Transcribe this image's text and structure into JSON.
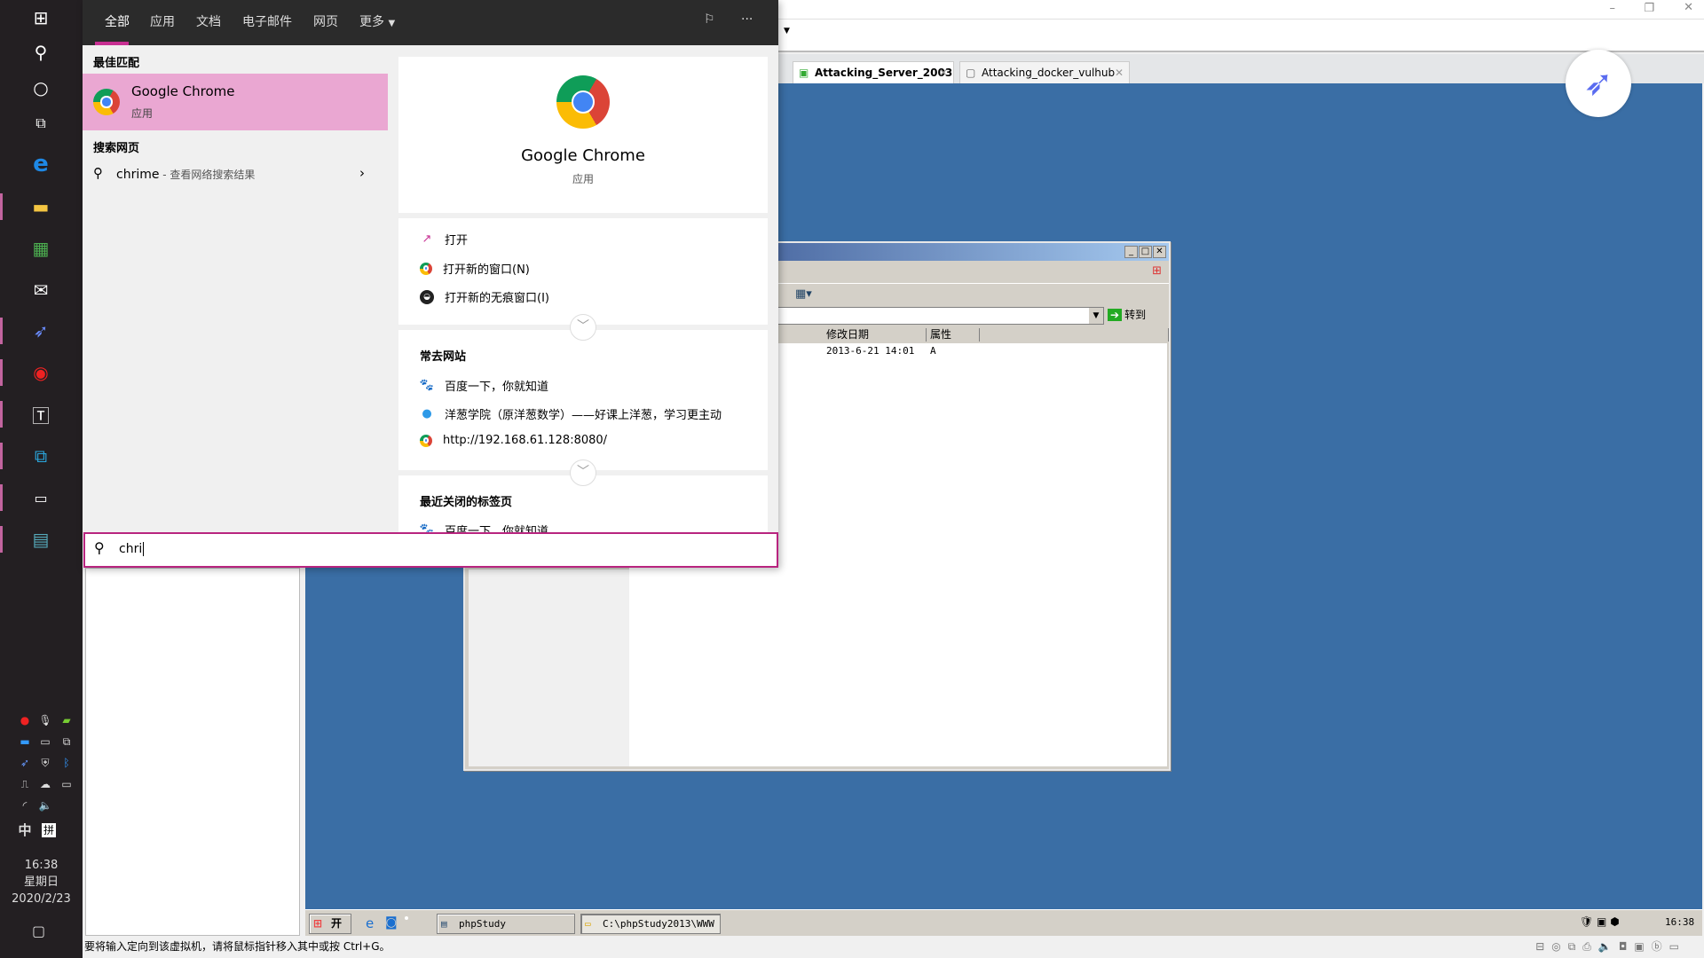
{
  "search_pane": {
    "tabs": [
      "全部",
      "应用",
      "文档",
      "电子邮件",
      "网页",
      "更多"
    ],
    "best_match_heading": "最佳匹配",
    "best_match": {
      "title": "Google Chrome",
      "subtitle": "应用"
    },
    "web_heading": "搜索网页",
    "web_result": {
      "query": "chrime",
      "suffix": " - 查看网络搜索结果"
    },
    "detail": {
      "title": "Google Chrome",
      "subtitle": "应用",
      "actions": [
        "打开",
        "打开新的窗口(N)",
        "打开新的无痕窗口(I)"
      ],
      "frequent_heading": "常去网站",
      "frequent": [
        "百度一下，你就知道",
        "洋葱学院（原洋葱数学）——好课上洋葱，学习更主动",
        "http://192.168.61.128:8080/"
      ],
      "recent_heading": "最近关闭的标签页",
      "recent": [
        "百度一下，你就知道"
      ]
    },
    "search_value": "chri",
    "accent": "#c72f92"
  },
  "clock": {
    "time": "16:38",
    "weekday": "星期日",
    "date": "2020/2/23"
  },
  "tray": {
    "ime": "中",
    "ime2": "拼"
  },
  "vmware": {
    "tabs": [
      "Attacking_Server_2003",
      "Attacking_docker_vulhub"
    ],
    "status": "要将输入定向到该虚拟机，请将鼠标指针移入其中或按 Ctrl+G。"
  },
  "explorer": {
    "go_label": "转到",
    "columns": [
      "修改日期",
      "属性"
    ],
    "row": {
      "date": "2013-6-21 14:01",
      "attr": "A"
    }
  },
  "guest_taskbar": {
    "start": "开始",
    "buttons": [
      "phpStudy",
      "C:\\phpStudy2013\\WWW"
    ],
    "time": "16:38"
  },
  "colors": {
    "desktop": "#3a6ea5",
    "selected": "#eaa7d2"
  }
}
